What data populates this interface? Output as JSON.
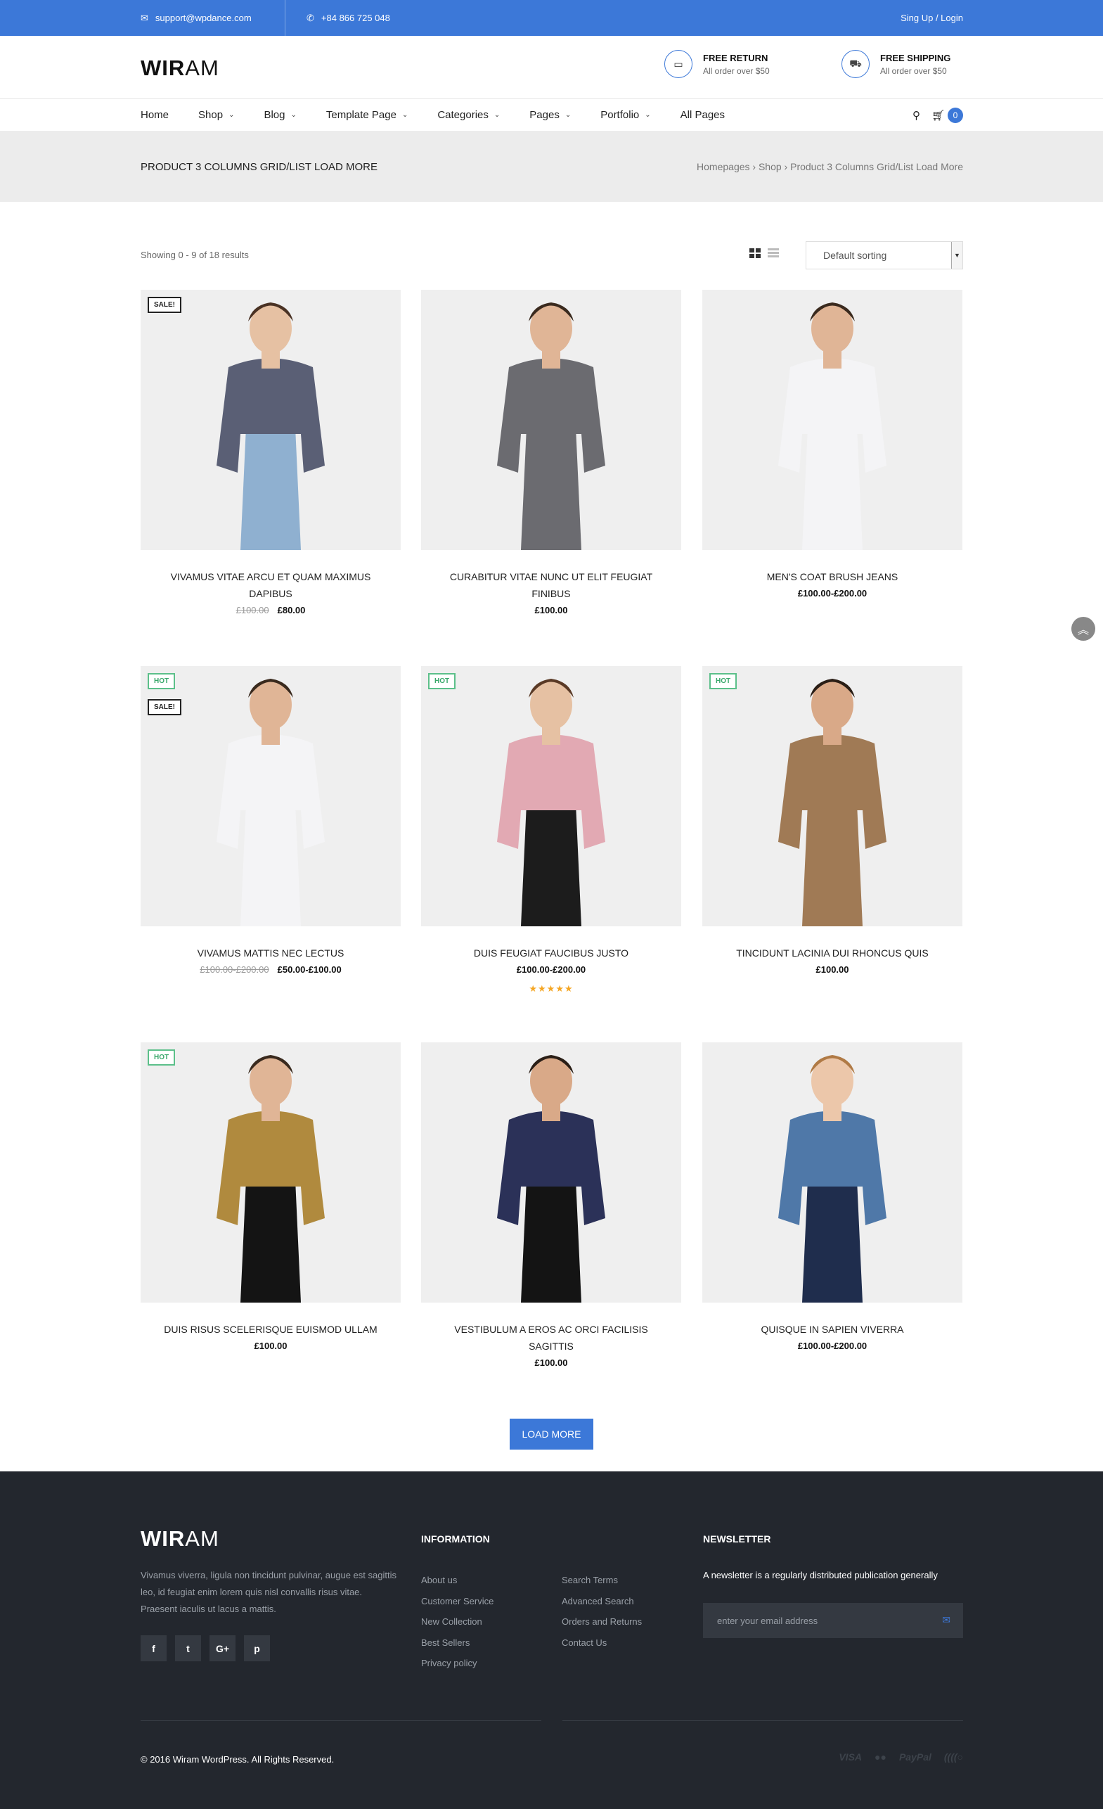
{
  "topbar": {
    "email": "support@wpdance.com",
    "phone": "+84 866 725 048",
    "account": "Sing Up / Login",
    "email_icon": "envelope-icon",
    "phone_icon": "phone-icon"
  },
  "header": {
    "logo_bold": "WIR",
    "logo_rest": "AM",
    "features": [
      {
        "title": "FREE RETURN",
        "subtitle": "All order over $50",
        "icon": "money-icon"
      },
      {
        "title": "FREE SHIPPING",
        "subtitle": "All order over $50",
        "icon": "truck-icon"
      }
    ]
  },
  "nav": {
    "items": [
      {
        "label": "Home",
        "dropdown": false
      },
      {
        "label": "Shop",
        "dropdown": true
      },
      {
        "label": "Blog",
        "dropdown": true
      },
      {
        "label": "Template Page",
        "dropdown": true
      },
      {
        "label": "Categories",
        "dropdown": true
      },
      {
        "label": "Pages",
        "dropdown": true
      },
      {
        "label": "Portfolio",
        "dropdown": true
      },
      {
        "label": "All Pages",
        "dropdown": false
      }
    ],
    "cart_count": "0"
  },
  "page_title": {
    "heading": "PRODUCT 3 COLUMNS GRID/LIST LOAD MORE",
    "breadcrumb": "Homepages › Shop › Product 3 Columns Grid/List Load More"
  },
  "toolbar": {
    "results": "Showing 0 - 9 of 18 results",
    "sort_selected": "Default sorting"
  },
  "products": [
    {
      "name": "VIVAMUS VITAE ARCU ET QUAM MAXIMUS DAPIBUS",
      "old_price": "£100.00",
      "price": "£80.00",
      "badges": [
        "SALE!"
      ],
      "colors": {
        "top": "#5a5f75",
        "bottom": "#8fb0d0",
        "skin": "#e6c1a3",
        "hair": "#4a3224"
      }
    },
    {
      "name": "CURABITUR VITAE NUNC UT ELIT FEUGIAT FINIBUS",
      "old_price": "",
      "price": "£100.00",
      "badges": [],
      "colors": {
        "top": "#6b6b70",
        "bottom": "#6b6b70",
        "skin": "#e0b596",
        "hair": "#3a2a1e"
      }
    },
    {
      "name": "MEN'S COAT BRUSH JEANS",
      "old_price": "",
      "price": "£100.00-£200.00",
      "badges": [],
      "colors": {
        "top": "#f4f4f6",
        "bottom": "#f4f4f6",
        "skin": "#e0b596",
        "hair": "#3a2a1e"
      }
    },
    {
      "name": "VIVAMUS MATTIS NEC LECTUS",
      "old_price": "£100.00-£200.00",
      "price": "£50.00-£100.00",
      "badges": [
        "HOT",
        "SALE!"
      ],
      "colors": {
        "top": "#f4f4f6",
        "bottom": "#f4f4f6",
        "skin": "#e0b596",
        "hair": "#3a2a1e"
      }
    },
    {
      "name": "DUIS FEUGIAT FAUCIBUS JUSTO",
      "old_price": "",
      "price": "£100.00-£200.00",
      "badges": [
        "HOT"
      ],
      "rating": 5,
      "colors": {
        "top": "#e2a9b3",
        "bottom": "#1c1c1c",
        "skin": "#e6c1a3",
        "hair": "#5a3a26"
      }
    },
    {
      "name": "TINCIDUNT LACINIA DUI RHONCUS QUIS",
      "old_price": "",
      "price": "£100.00",
      "badges": [
        "HOT"
      ],
      "colors": {
        "top": "#a07a55",
        "bottom": "#a07a55",
        "skin": "#d9a988",
        "hair": "#2a1e16"
      }
    },
    {
      "name": "DUIS RISUS SCELERISQUE EUISMOD ULLAM",
      "old_price": "",
      "price": "£100.00",
      "badges": [
        "HOT"
      ],
      "colors": {
        "top": "#b08a3e",
        "bottom": "#141414",
        "skin": "#e0b596",
        "hair": "#3a2a1e"
      }
    },
    {
      "name": "VESTIBULUM A EROS AC ORCI FACILISIS SAGITTIS",
      "old_price": "",
      "price": "£100.00",
      "badges": [],
      "colors": {
        "top": "#2b3158",
        "bottom": "#141414",
        "skin": "#d9a988",
        "hair": "#2a1e16"
      }
    },
    {
      "name": "QUISQUE IN SAPIEN VIVERRA",
      "old_price": "",
      "price": "£100.00-£200.00",
      "badges": [],
      "colors": {
        "top": "#4f78a8",
        "bottom": "#1f2d4d",
        "skin": "#ecc7aa",
        "hair": "#b07a45"
      }
    }
  ],
  "load_more": "LOAD MORE",
  "footer": {
    "logo_bold": "WIR",
    "logo_rest": "AM",
    "description": "Vivamus viverra, ligula non tincidunt pulvinar, augue est sagittis leo, id feugiat enim lorem quis nisl convallis risus vitae. Praesent iaculis ut lacus a mattis.",
    "social": [
      "f",
      "t",
      "G+",
      "p"
    ],
    "info_heading": "INFORMATION",
    "links_col1": [
      "About us",
      "Customer Service",
      "New Collection",
      "Best Sellers",
      "Privacy policy"
    ],
    "links_col2": [
      "Search Terms",
      "Advanced Search",
      "Orders and Returns",
      "Contact Us"
    ],
    "newsletter_heading": "NEWSLETTER",
    "newsletter_text": "A newsletter is a regularly distributed publication generally",
    "newsletter_placeholder": "enter your email address",
    "copyright": "© 2016 Wiram WordPress. All Rights Reserved.",
    "payments": [
      "VISA",
      "●●",
      "PayPal",
      "((((○"
    ]
  }
}
